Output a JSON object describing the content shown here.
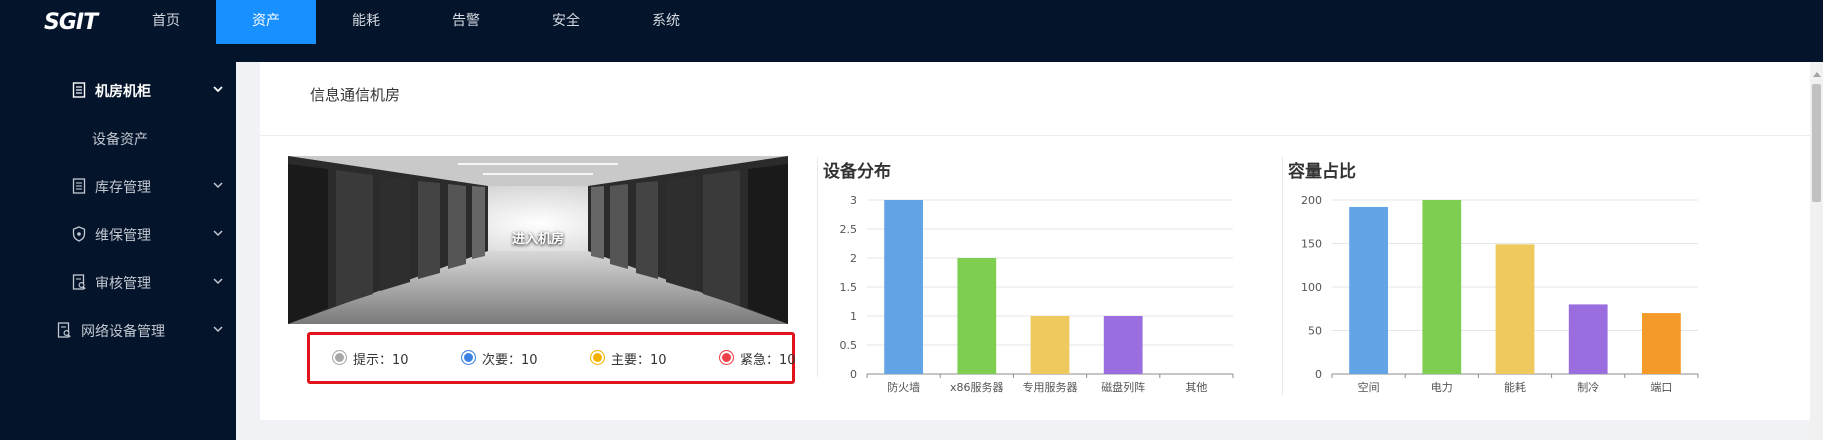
{
  "topnav": {
    "logo": "SGIT",
    "items": [
      {
        "label": "首页",
        "active": false
      },
      {
        "label": "资产",
        "active": true
      },
      {
        "label": "能耗",
        "active": false
      },
      {
        "label": "告警",
        "active": false
      },
      {
        "label": "安全",
        "active": false
      },
      {
        "label": "系统",
        "active": false
      }
    ]
  },
  "sidebar": {
    "items": [
      {
        "label": "机房机柜",
        "icon": "rack-icon",
        "expanded": true
      },
      {
        "label": "设备资产",
        "icon": "",
        "sub": true
      },
      {
        "label": "库存管理",
        "icon": "inventory-icon"
      },
      {
        "label": "维保管理",
        "icon": "shield-icon"
      },
      {
        "label": "审核管理",
        "icon": "audit-icon"
      },
      {
        "label": "网络设备管理",
        "icon": "network-device-icon"
      }
    ]
  },
  "main": {
    "title": "信息通信机房",
    "room_button": "进入机房",
    "alarms": [
      {
        "label": "提示：10",
        "color": "#a8a8a8"
      },
      {
        "label": "次要：10",
        "color": "#3b82e6"
      },
      {
        "label": "主要：10",
        "color": "#f5b301"
      },
      {
        "label": "紧急：10",
        "color": "#f04048"
      }
    ]
  },
  "chart_data": [
    {
      "type": "bar",
      "title": "设备分布",
      "categories": [
        "防火墙",
        "x86服务器",
        "专用服务器",
        "磁盘列阵",
        "其他"
      ],
      "values": [
        3,
        2,
        1,
        1,
        0
      ],
      "colors": [
        "#62a4e6",
        "#7ecf51",
        "#eec95e",
        "#9b6ee0",
        "#f49a28"
      ],
      "yticks": [
        "0",
        "0.5",
        "1",
        "1.5",
        "2",
        "2.5",
        "3"
      ],
      "ylim": [
        0,
        3
      ]
    },
    {
      "type": "bar",
      "title": "容量占比",
      "categories": [
        "空间",
        "电力",
        "能耗",
        "制冷",
        "端口"
      ],
      "values": [
        192,
        200,
        149,
        80,
        70
      ],
      "colors": [
        "#62a4e6",
        "#7ecf51",
        "#eec95e",
        "#9b6ee0",
        "#f49a28"
      ],
      "yticks": [
        "0",
        "50",
        "100",
        "150",
        "200"
      ],
      "ylim": [
        0,
        200
      ]
    }
  ]
}
